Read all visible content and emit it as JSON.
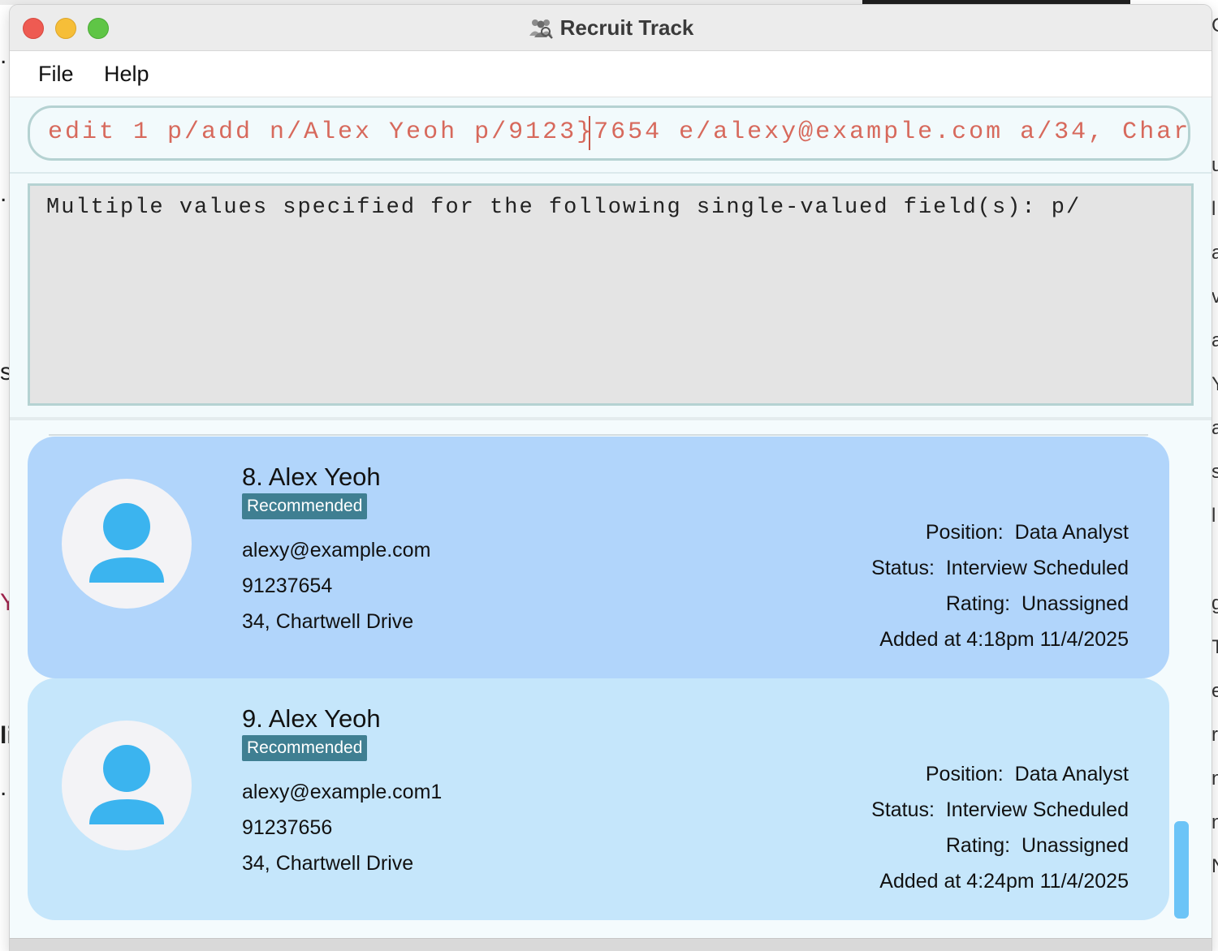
{
  "window": {
    "title": "Recruit Track",
    "icon": "recruit-track-app-icon"
  },
  "menu": {
    "file": "File",
    "help": "Help"
  },
  "command": {
    "value": "edit 1 p/add n/Alex Yeoh p/9123}7654 e/alexy@example.com a/34, Char"
  },
  "result": {
    "message": "Multiple values specified for the following single-valued field(s): p/"
  },
  "cards": [
    {
      "name": "8. Alex Yeoh",
      "tag": "Recommended",
      "email": "alexy@example.com",
      "phone": "91237654",
      "address": "34, Chartwell Drive",
      "position": "Position:  Data Analyst",
      "status": "Status:  Interview Scheduled",
      "rating": "Rating:  Unassigned",
      "added": "Added at 4:18pm 11/4/2025"
    },
    {
      "name": "9. Alex Yeoh",
      "tag": "Recommended",
      "email": "alexy@example.com1",
      "phone": "91237656",
      "address": "34, Chartwell Drive",
      "position": "Position:  Data Analyst",
      "status": "Status:  Interview Scheduled",
      "rating": "Rating:  Unassigned",
      "added": "Added at 4:24pm 11/4/2025"
    }
  ],
  "background_fragments": {
    "left": [
      ".",
      ".",
      "s",
      "Y",
      "li",
      "."
    ],
    "right": [
      "C",
      "u",
      "l",
      "a",
      "v",
      "a",
      "Y",
      "a",
      "s",
      "l",
      "g",
      "T",
      "e",
      "r",
      "n",
      "n",
      "N"
    ]
  },
  "colors": {
    "accent_text": "#d7695c",
    "card_selected": "#b1d5fb",
    "card_default": "#c5e6fb",
    "badge": "#3f7f92",
    "avatar_icon": "#3bb4ef"
  }
}
